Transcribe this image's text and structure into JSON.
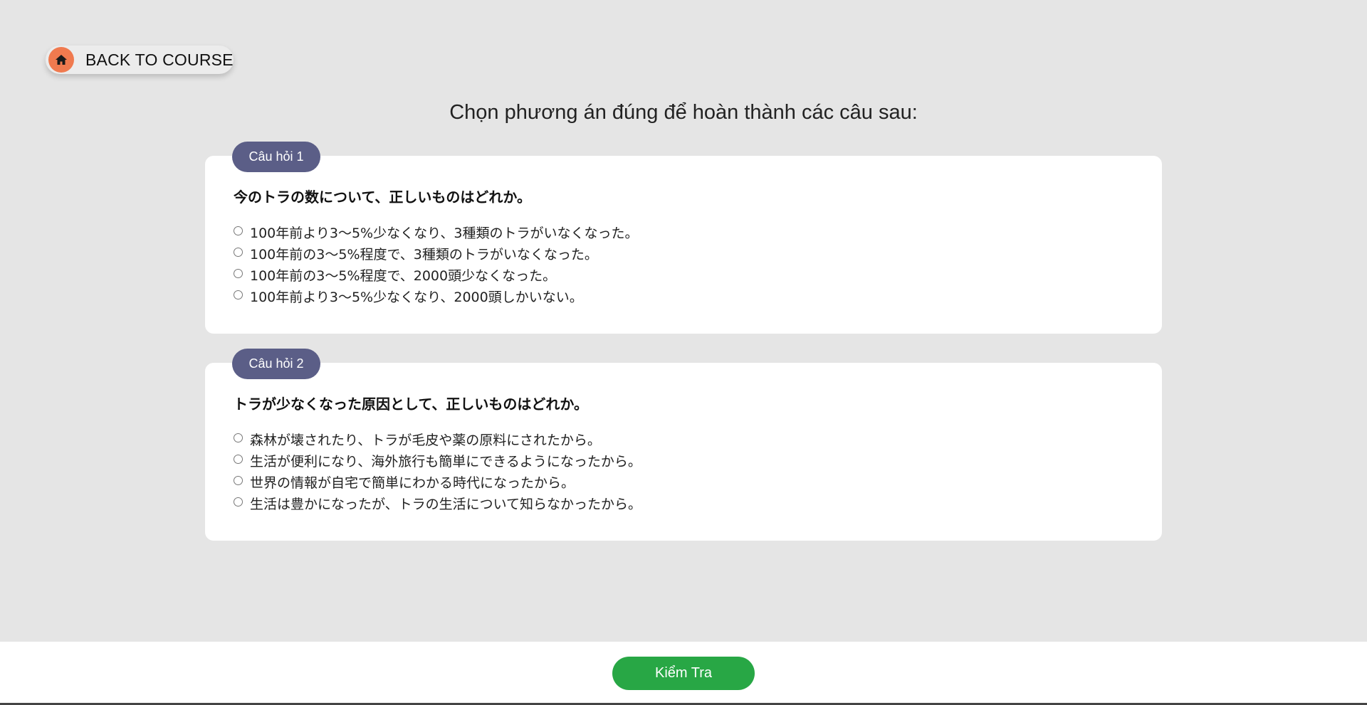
{
  "header": {
    "back_label": "BACK TO COURSE",
    "home_icon": "home-icon",
    "home_color": "#f07a4f"
  },
  "instruction": "Chọn phương án đúng để hoàn thành các câu sau:",
  "questions": [
    {
      "badge": "Câu hỏi 1",
      "text": "今のトラの数について、正しいものはどれか。",
      "options": [
        "100年前より3～5%少なくなり、3種類のトラがいなくなった。",
        "100年前の3～5%程度で、3種類のトラがいなくなった。",
        "100年前の3～5%程度で、2000頭少なくなった。",
        "100年前より3～5%少なくなり、2000頭しかいない。"
      ]
    },
    {
      "badge": "Câu hỏi 2",
      "text": "トラが少なくなった原因として、正しいものはどれか。",
      "options": [
        "森林が壊されたり、トラが毛皮や薬の原料にされたから。",
        "生活が便利になり、海外旅行も簡単にできるようになったから。",
        "世界の情報が自宅で簡単にわかる時代になったから。",
        "生活は豊かになったが、トラの生活について知らなかったから。"
      ]
    }
  ],
  "footer": {
    "check_label": "Kiểm Tra",
    "check_color": "#28a745"
  },
  "colors": {
    "background": "#e5e5e5",
    "badge": "#5b5e87"
  }
}
